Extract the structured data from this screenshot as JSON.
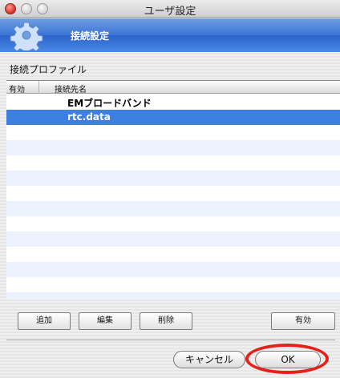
{
  "window": {
    "title": "ユーザ設定"
  },
  "header": {
    "title": "接続設定",
    "icon": "gear-icon"
  },
  "section": {
    "label": "接続プロファイル"
  },
  "table": {
    "columns": [
      "有効",
      "接続先名"
    ],
    "rows": [
      {
        "name": "EMブロードバンド",
        "selected": false
      },
      {
        "name": "rtc.data",
        "selected": true
      }
    ]
  },
  "actions": {
    "add_label": "追加",
    "edit_label": "編集",
    "delete_label": "削除",
    "enable_label": "有効"
  },
  "footer": {
    "cancel_label": "キャンセル",
    "ok_label": "OK"
  },
  "colors": {
    "selection": "#3d80df",
    "header_blue": "#3b74d6",
    "highlight_ring": "#e8201c"
  }
}
